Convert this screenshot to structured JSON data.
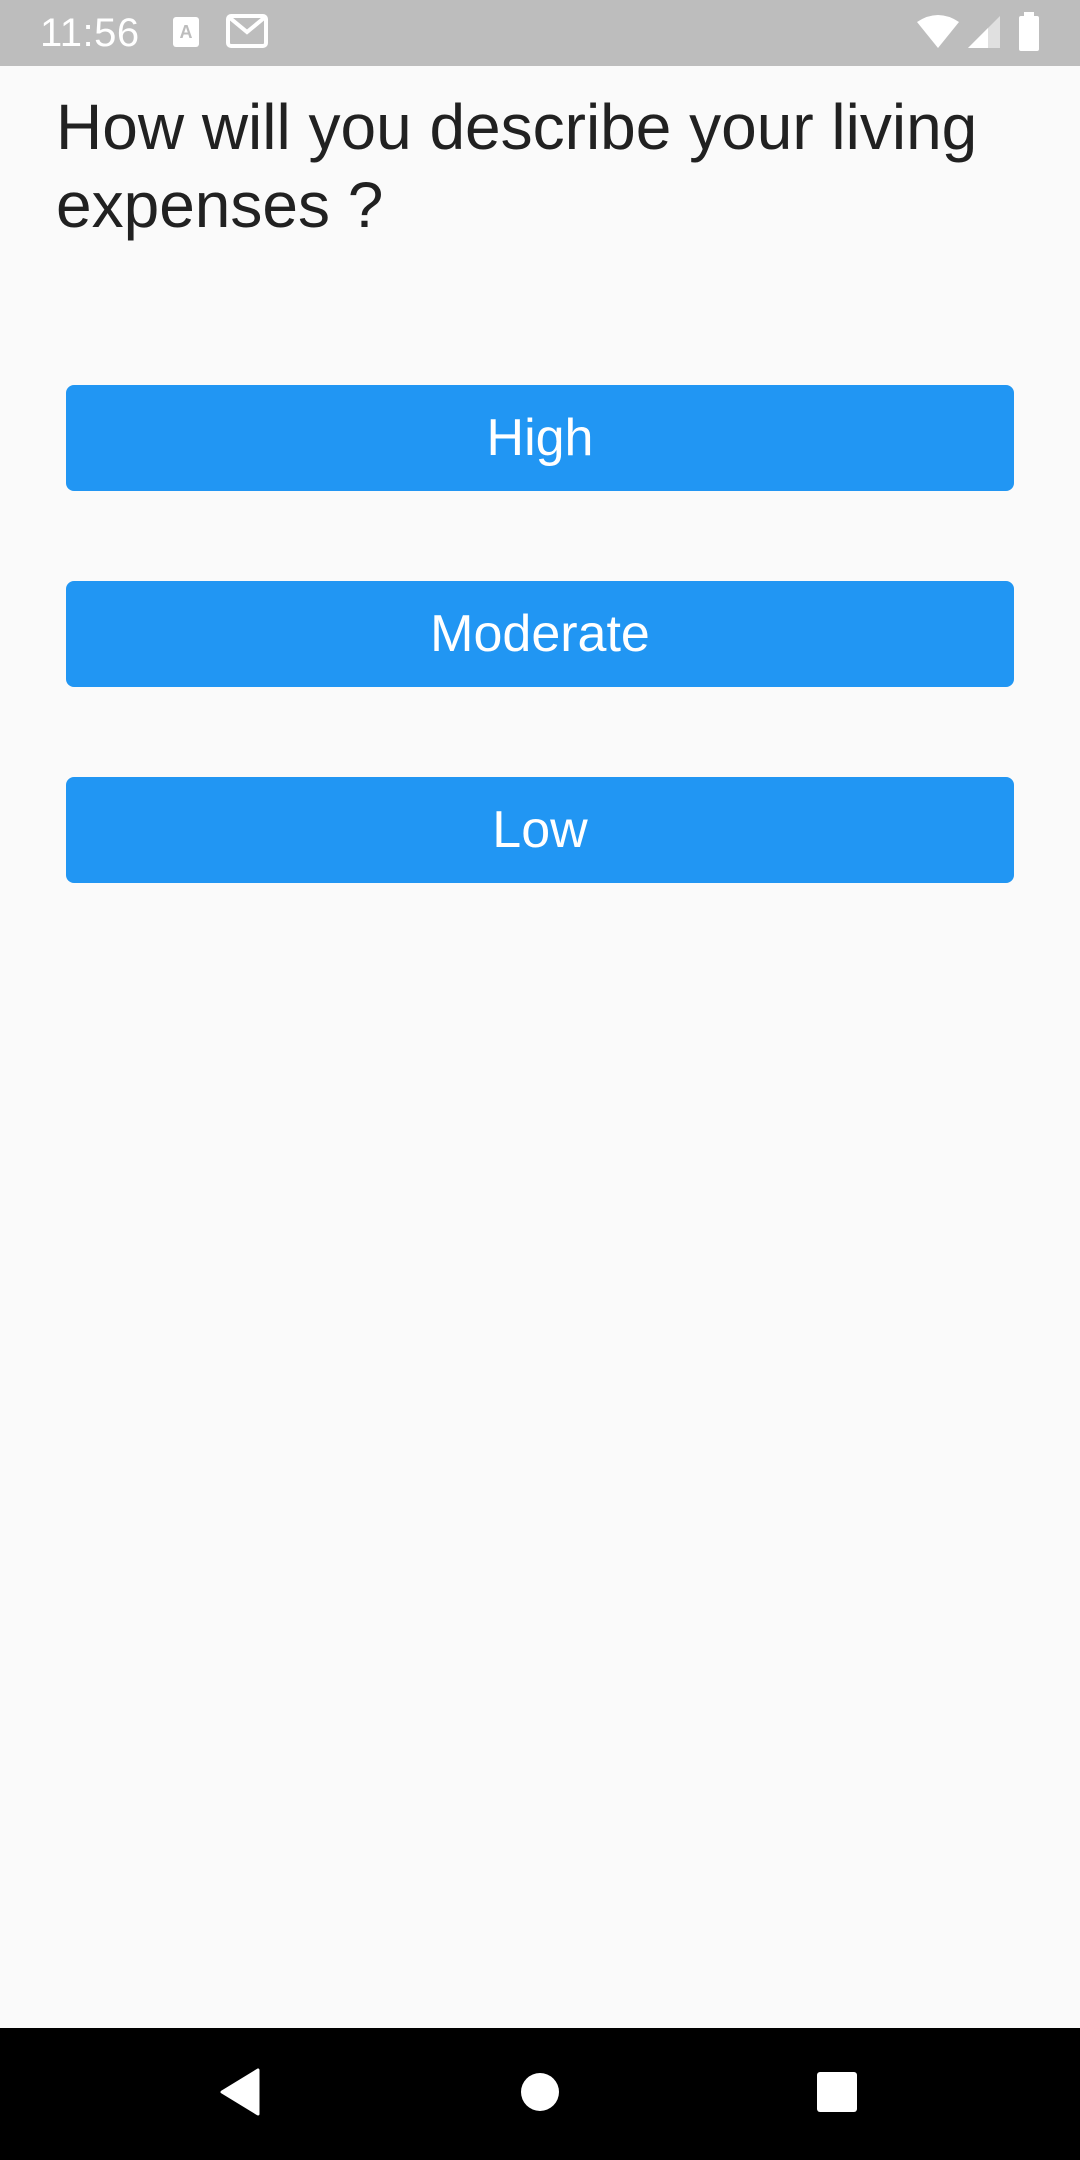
{
  "status_bar": {
    "time": "11:56",
    "background": "#bdbdbd",
    "icons": [
      "text-a-notification-icon",
      "gmail-notification-icon",
      "wifi-icon",
      "cell-signal-icon",
      "battery-icon"
    ]
  },
  "question": {
    "text": "How will you describe your living expenses ?"
  },
  "options": [
    {
      "label": "High"
    },
    {
      "label": "Moderate"
    },
    {
      "label": "Low"
    }
  ],
  "colors": {
    "button": "#2196f3",
    "background": "#fafafa",
    "text": "#212121"
  },
  "nav_bar": {
    "icons": [
      "back-icon",
      "home-icon",
      "recents-icon"
    ]
  }
}
